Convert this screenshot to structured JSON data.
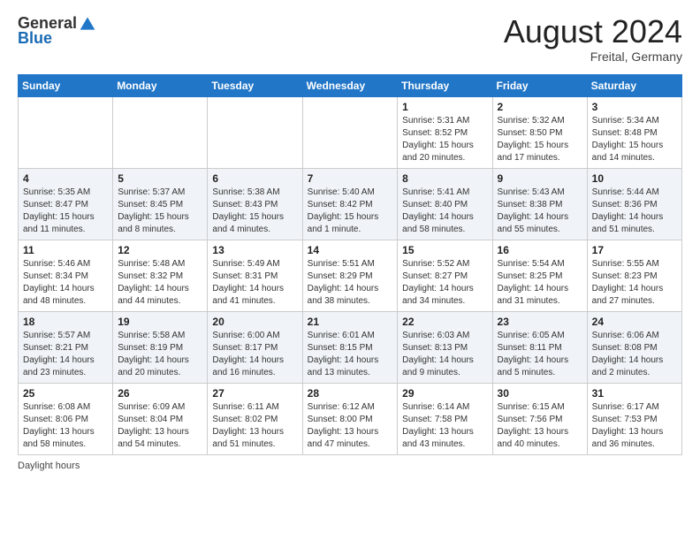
{
  "header": {
    "logo_general": "General",
    "logo_blue": "Blue",
    "month_year": "August 2024",
    "location": "Freital, Germany"
  },
  "days_of_week": [
    "Sunday",
    "Monday",
    "Tuesday",
    "Wednesday",
    "Thursday",
    "Friday",
    "Saturday"
  ],
  "weeks": [
    [
      {
        "num": "",
        "sunrise": "",
        "sunset": "",
        "daylight": ""
      },
      {
        "num": "",
        "sunrise": "",
        "sunset": "",
        "daylight": ""
      },
      {
        "num": "",
        "sunrise": "",
        "sunset": "",
        "daylight": ""
      },
      {
        "num": "",
        "sunrise": "",
        "sunset": "",
        "daylight": ""
      },
      {
        "num": "1",
        "sunrise": "Sunrise: 5:31 AM",
        "sunset": "Sunset: 8:52 PM",
        "daylight": "Daylight: 15 hours and 20 minutes."
      },
      {
        "num": "2",
        "sunrise": "Sunrise: 5:32 AM",
        "sunset": "Sunset: 8:50 PM",
        "daylight": "Daylight: 15 hours and 17 minutes."
      },
      {
        "num": "3",
        "sunrise": "Sunrise: 5:34 AM",
        "sunset": "Sunset: 8:48 PM",
        "daylight": "Daylight: 15 hours and 14 minutes."
      }
    ],
    [
      {
        "num": "4",
        "sunrise": "Sunrise: 5:35 AM",
        "sunset": "Sunset: 8:47 PM",
        "daylight": "Daylight: 15 hours and 11 minutes."
      },
      {
        "num": "5",
        "sunrise": "Sunrise: 5:37 AM",
        "sunset": "Sunset: 8:45 PM",
        "daylight": "Daylight: 15 hours and 8 minutes."
      },
      {
        "num": "6",
        "sunrise": "Sunrise: 5:38 AM",
        "sunset": "Sunset: 8:43 PM",
        "daylight": "Daylight: 15 hours and 4 minutes."
      },
      {
        "num": "7",
        "sunrise": "Sunrise: 5:40 AM",
        "sunset": "Sunset: 8:42 PM",
        "daylight": "Daylight: 15 hours and 1 minute."
      },
      {
        "num": "8",
        "sunrise": "Sunrise: 5:41 AM",
        "sunset": "Sunset: 8:40 PM",
        "daylight": "Daylight: 14 hours and 58 minutes."
      },
      {
        "num": "9",
        "sunrise": "Sunrise: 5:43 AM",
        "sunset": "Sunset: 8:38 PM",
        "daylight": "Daylight: 14 hours and 55 minutes."
      },
      {
        "num": "10",
        "sunrise": "Sunrise: 5:44 AM",
        "sunset": "Sunset: 8:36 PM",
        "daylight": "Daylight: 14 hours and 51 minutes."
      }
    ],
    [
      {
        "num": "11",
        "sunrise": "Sunrise: 5:46 AM",
        "sunset": "Sunset: 8:34 PM",
        "daylight": "Daylight: 14 hours and 48 minutes."
      },
      {
        "num": "12",
        "sunrise": "Sunrise: 5:48 AM",
        "sunset": "Sunset: 8:32 PM",
        "daylight": "Daylight: 14 hours and 44 minutes."
      },
      {
        "num": "13",
        "sunrise": "Sunrise: 5:49 AM",
        "sunset": "Sunset: 8:31 PM",
        "daylight": "Daylight: 14 hours and 41 minutes."
      },
      {
        "num": "14",
        "sunrise": "Sunrise: 5:51 AM",
        "sunset": "Sunset: 8:29 PM",
        "daylight": "Daylight: 14 hours and 38 minutes."
      },
      {
        "num": "15",
        "sunrise": "Sunrise: 5:52 AM",
        "sunset": "Sunset: 8:27 PM",
        "daylight": "Daylight: 14 hours and 34 minutes."
      },
      {
        "num": "16",
        "sunrise": "Sunrise: 5:54 AM",
        "sunset": "Sunset: 8:25 PM",
        "daylight": "Daylight: 14 hours and 31 minutes."
      },
      {
        "num": "17",
        "sunrise": "Sunrise: 5:55 AM",
        "sunset": "Sunset: 8:23 PM",
        "daylight": "Daylight: 14 hours and 27 minutes."
      }
    ],
    [
      {
        "num": "18",
        "sunrise": "Sunrise: 5:57 AM",
        "sunset": "Sunset: 8:21 PM",
        "daylight": "Daylight: 14 hours and 23 minutes."
      },
      {
        "num": "19",
        "sunrise": "Sunrise: 5:58 AM",
        "sunset": "Sunset: 8:19 PM",
        "daylight": "Daylight: 14 hours and 20 minutes."
      },
      {
        "num": "20",
        "sunrise": "Sunrise: 6:00 AM",
        "sunset": "Sunset: 8:17 PM",
        "daylight": "Daylight: 14 hours and 16 minutes."
      },
      {
        "num": "21",
        "sunrise": "Sunrise: 6:01 AM",
        "sunset": "Sunset: 8:15 PM",
        "daylight": "Daylight: 14 hours and 13 minutes."
      },
      {
        "num": "22",
        "sunrise": "Sunrise: 6:03 AM",
        "sunset": "Sunset: 8:13 PM",
        "daylight": "Daylight: 14 hours and 9 minutes."
      },
      {
        "num": "23",
        "sunrise": "Sunrise: 6:05 AM",
        "sunset": "Sunset: 8:11 PM",
        "daylight": "Daylight: 14 hours and 5 minutes."
      },
      {
        "num": "24",
        "sunrise": "Sunrise: 6:06 AM",
        "sunset": "Sunset: 8:08 PM",
        "daylight": "Daylight: 14 hours and 2 minutes."
      }
    ],
    [
      {
        "num": "25",
        "sunrise": "Sunrise: 6:08 AM",
        "sunset": "Sunset: 8:06 PM",
        "daylight": "Daylight: 13 hours and 58 minutes."
      },
      {
        "num": "26",
        "sunrise": "Sunrise: 6:09 AM",
        "sunset": "Sunset: 8:04 PM",
        "daylight": "Daylight: 13 hours and 54 minutes."
      },
      {
        "num": "27",
        "sunrise": "Sunrise: 6:11 AM",
        "sunset": "Sunset: 8:02 PM",
        "daylight": "Daylight: 13 hours and 51 minutes."
      },
      {
        "num": "28",
        "sunrise": "Sunrise: 6:12 AM",
        "sunset": "Sunset: 8:00 PM",
        "daylight": "Daylight: 13 hours and 47 minutes."
      },
      {
        "num": "29",
        "sunrise": "Sunrise: 6:14 AM",
        "sunset": "Sunset: 7:58 PM",
        "daylight": "Daylight: 13 hours and 43 minutes."
      },
      {
        "num": "30",
        "sunrise": "Sunrise: 6:15 AM",
        "sunset": "Sunset: 7:56 PM",
        "daylight": "Daylight: 13 hours and 40 minutes."
      },
      {
        "num": "31",
        "sunrise": "Sunrise: 6:17 AM",
        "sunset": "Sunset: 7:53 PM",
        "daylight": "Daylight: 13 hours and 36 minutes."
      }
    ]
  ],
  "footer": {
    "note": "Daylight hours"
  }
}
